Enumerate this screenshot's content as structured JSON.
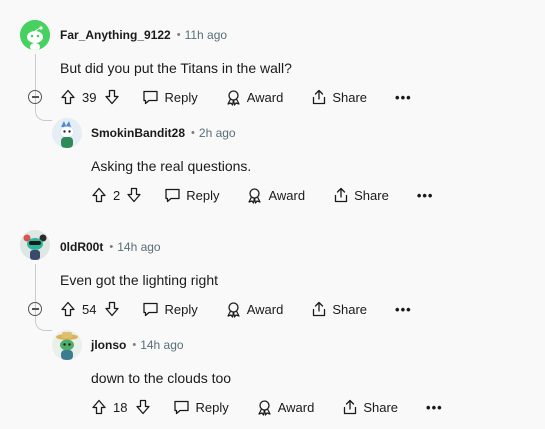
{
  "comments": [
    {
      "author": "Far_Anything_9122",
      "time": "11h ago",
      "body": "But did you put the Titans in the wall?",
      "votes": "39",
      "reply_label": "Reply",
      "award_label": "Award",
      "share_label": "Share",
      "more_label": "•••"
    },
    {
      "author": "SmokinBandit28",
      "time": "2h ago",
      "body": "Asking the real questions.",
      "votes": "2",
      "reply_label": "Reply",
      "award_label": "Award",
      "share_label": "Share",
      "more_label": "•••"
    },
    {
      "author": "0ldR00t",
      "time": "14h ago",
      "body": "Even got the lighting right",
      "votes": "54",
      "reply_label": "Reply",
      "award_label": "Award",
      "share_label": "Share",
      "more_label": "•••"
    },
    {
      "author": "jlonso",
      "time": "14h ago",
      "body": "down to the clouds too",
      "votes": "18",
      "reply_label": "Reply",
      "award_label": "Award",
      "share_label": "Share",
      "more_label": "•••"
    }
  ],
  "separator": "•",
  "colors": {
    "background": "#f9f9f9",
    "text": "#1a1a1b",
    "meta": "#576f76",
    "thread_line": "#c8cbcd",
    "snoo_avatar_bg": "#46d160"
  }
}
